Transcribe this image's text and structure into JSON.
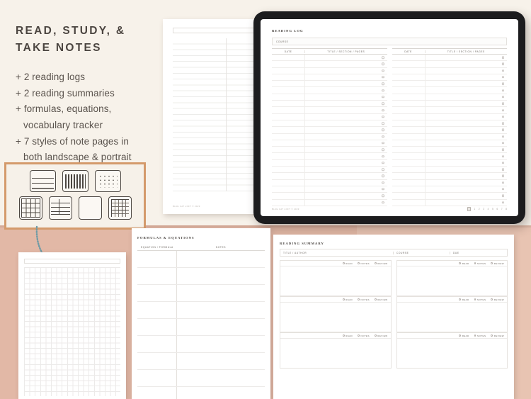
{
  "headline": {
    "line1": "Read, Study, &",
    "line2": "Take Notes"
  },
  "bullets": [
    {
      "text": "+ 2 reading logs"
    },
    {
      "text": "+ 2 reading summaries"
    },
    {
      "text": "+ formulas, equations,"
    },
    {
      "text": "vocabulary tracker",
      "continuation": true
    },
    {
      "text": "+ 7 styles of note pages in"
    },
    {
      "text": "both landscape & portrait",
      "continuation": true
    }
  ],
  "style_thumbnails": {
    "row1": [
      "lined-paper",
      "dashed-paper",
      "dotted-paper"
    ],
    "row2": [
      "grid-paper",
      "cornell-paper",
      "blank-paper",
      "graph-paper"
    ]
  },
  "tablet": {
    "page": {
      "title": "Reading Log",
      "course_label": "Course",
      "columns": [
        "Date",
        "Title / Section / Pages"
      ],
      "row_count": 23,
      "footer": "Blue Cat Loft © 2023",
      "page_numbers": [
        "1",
        "2",
        "3",
        "4",
        "5",
        "6",
        "7",
        "8"
      ],
      "page_icon": "book-icon"
    }
  },
  "back_paper": {
    "footer": "Blue Cat Loft © 2023",
    "line_count": 26
  },
  "formulas_page": {
    "title": "Formulas & Equations",
    "columns": [
      "Equation / Formula",
      "Notes"
    ],
    "row_count": 9
  },
  "summary_page": {
    "title": "Reading Summary",
    "columns": [
      "Title / Author",
      "Course",
      "Due"
    ],
    "checkboxes": [
      "Read",
      "Notes",
      "Review"
    ],
    "entries_per_column": 3
  },
  "colors": {
    "page_background": "#f7f2ea",
    "rose_band": "#e2b8a6",
    "rose_band_light": "#e8c4b2",
    "accent_border": "#d49a6b",
    "arrow": "#6f9ba5",
    "heading_text": "#4b4540",
    "body_text": "#5a534d",
    "tablet_body": "#1c1c1e"
  }
}
